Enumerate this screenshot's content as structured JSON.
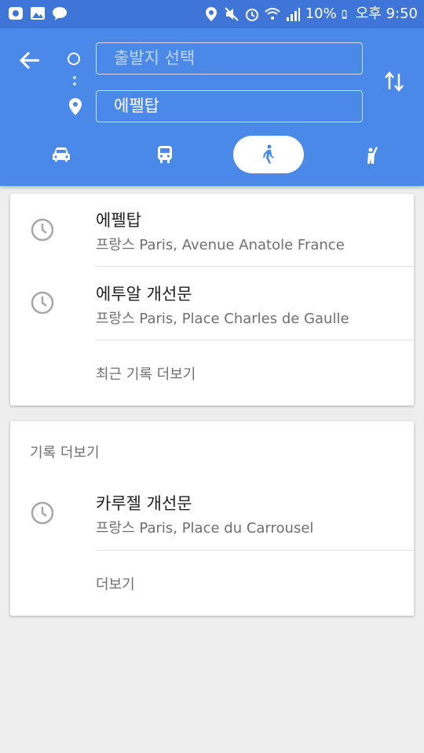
{
  "status_bar": {
    "battery": "10%",
    "time": "오후 9:50"
  },
  "header": {
    "origin_placeholder": "출발지 선택",
    "destination": "에펠탑",
    "modes": [
      "drive",
      "transit",
      "walk",
      "ride"
    ],
    "selected_mode": "walk",
    "accent_color": "#4a89e8"
  },
  "recent": {
    "items": [
      {
        "title": "에펠탑",
        "subtitle": "프랑스 Paris, Avenue Anatole France"
      },
      {
        "title": "에투알 개선문",
        "subtitle": "프랑스 Paris, Place Charles de Gaulle"
      }
    ],
    "more_label": "최근 기록 더보기"
  },
  "history": {
    "header": "기록 더보기",
    "items": [
      {
        "title": "카루젤 개선문",
        "subtitle": "프랑스 Paris, Place du Carrousel"
      }
    ],
    "more_label": "더보기"
  }
}
